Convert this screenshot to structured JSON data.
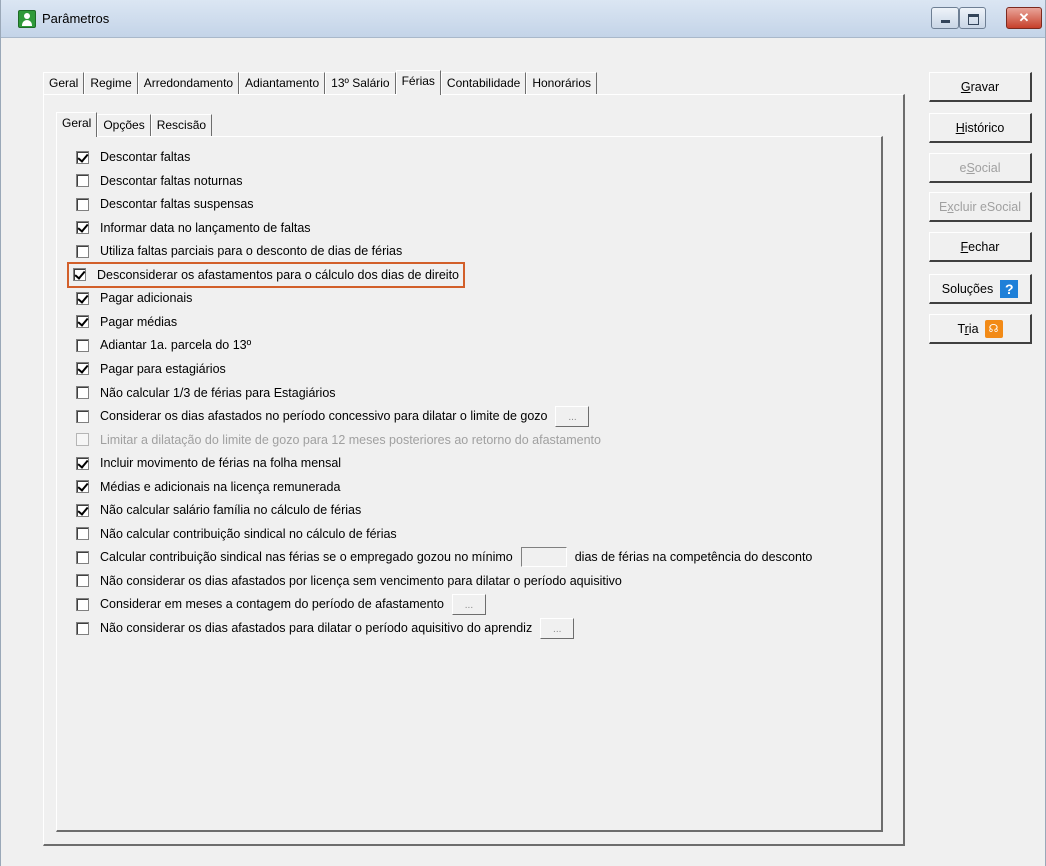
{
  "window": {
    "title": "Parâmetros"
  },
  "main_tabs": [
    {
      "label": "Geral",
      "active": false
    },
    {
      "label": "Regime",
      "active": false
    },
    {
      "label": "Arredondamento",
      "active": false
    },
    {
      "label": "Adiantamento",
      "active": false
    },
    {
      "label": "13º Salário",
      "active": false
    },
    {
      "label": "Férias",
      "active": true
    },
    {
      "label": "Contabilidade",
      "active": false
    },
    {
      "label": "Honorários",
      "active": false
    }
  ],
  "sub_tabs": [
    {
      "label": "Geral",
      "active": true
    },
    {
      "label": "Opções",
      "active": false
    },
    {
      "label": "Rescisão",
      "active": false
    }
  ],
  "options": [
    {
      "label": "Descontar faltas",
      "checked": true
    },
    {
      "label": "Descontar faltas noturnas",
      "checked": false
    },
    {
      "label": "Descontar faltas suspensas",
      "checked": false
    },
    {
      "label": "Informar data no lançamento de faltas",
      "checked": true
    },
    {
      "label": "Utiliza faltas parciais para o desconto de dias de férias",
      "checked": false
    },
    {
      "label": "Desconsiderar os afastamentos para o cálculo dos dias de direito",
      "checked": true,
      "highlighted": true
    },
    {
      "label": "Pagar adicionais",
      "checked": true
    },
    {
      "label": "Pagar médias",
      "checked": true
    },
    {
      "label": "Adiantar 1a. parcela do 13º",
      "checked": false
    },
    {
      "label": "Pagar para estagiários",
      "checked": true
    },
    {
      "label": "Não calcular 1/3 de férias para Estagiários",
      "checked": false
    },
    {
      "label": "Considerar os dias afastados no período concessivo para dilatar o limite de gozo",
      "checked": false,
      "ellipsis": "..."
    },
    {
      "label": "Limitar a dilatação do limite de gozo para 12 meses posteriores ao retorno do afastamento",
      "checked": false,
      "disabled": true
    },
    {
      "label": "Incluir movimento de férias na folha mensal",
      "checked": true
    },
    {
      "label": "Médias e adicionais na licença remunerada",
      "checked": true
    },
    {
      "label": "Não calcular salário família no cálculo de férias",
      "checked": true
    },
    {
      "label": "Não calcular contribuição sindical no cálculo de férias",
      "checked": false
    },
    {
      "label": "Calcular contribuição sindical nas férias se o empregado gozou no mínimo",
      "checked": false,
      "field_value": "",
      "tail": "dias de férias na competência do desconto"
    },
    {
      "label": "Não considerar os dias afastados por licença sem vencimento para dilatar o período aquisitivo",
      "checked": false
    },
    {
      "label": "Considerar em meses a contagem do período de afastamento",
      "checked": false,
      "ellipsis": "..."
    },
    {
      "label": "Não considerar os dias afastados para dilatar o período aquisitivo do aprendiz",
      "checked": false,
      "ellipsis": "..."
    }
  ],
  "side_buttons": {
    "gravar": {
      "mnemonic": "G",
      "rest": "ravar"
    },
    "historico": {
      "mnemonic": "H",
      "rest": "istórico"
    },
    "esocial": {
      "pre": "e",
      "mnemonic": "S",
      "rest": "ocial"
    },
    "excluir_esocial": {
      "pre": "E",
      "mnemonic": "x",
      "rest": "cluir eSocial"
    },
    "fechar": {
      "mnemonic": "F",
      "rest": "echar"
    },
    "solucoes": {
      "label": "Soluções",
      "icon_glyph": "?"
    },
    "tria": {
      "pre": "T",
      "mnemonic": "r",
      "rest": "ia",
      "icon_glyph": "☊"
    }
  }
}
